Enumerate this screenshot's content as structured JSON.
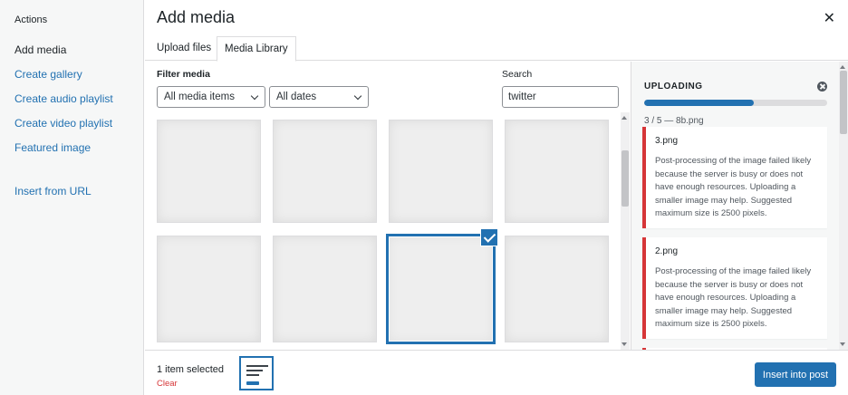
{
  "sidebar": {
    "heading": "Actions",
    "items": [
      {
        "label": "Add media"
      },
      {
        "label": "Create gallery"
      },
      {
        "label": "Create audio playlist"
      },
      {
        "label": "Create video playlist"
      },
      {
        "label": "Featured image"
      },
      {
        "label": "Insert from URL"
      }
    ]
  },
  "modal": {
    "title": "Add media",
    "close_icon": "close-icon"
  },
  "tabs": [
    {
      "label": "Upload files"
    },
    {
      "label": "Media Library",
      "active": true
    }
  ],
  "filters": {
    "label": "Filter media",
    "type_selected": "All media items",
    "date_selected": "All dates"
  },
  "search": {
    "label": "Search",
    "value": "twitter"
  },
  "uploader": {
    "title": "UPLOADING",
    "progress": 0.6,
    "status": "3 / 5  —  8b.png",
    "errors": [
      {
        "file": "3.png",
        "message": "Post-processing of the image failed likely because the server is busy or does not have enough resources. Uploading a smaller image may help. Suggested maximum size is 2500 pixels."
      },
      {
        "file": "2.png",
        "message": "Post-processing of the image failed likely because the server is busy or does not have enough resources. Uploading a smaller image may help. Suggested maximum size is 2500 pixels."
      }
    ]
  },
  "footer": {
    "selected_count": "1 item selected",
    "clear_label": "Clear",
    "insert_label": "Insert into post"
  },
  "colors": {
    "accent": "#2271b1",
    "error": "#d63638"
  }
}
